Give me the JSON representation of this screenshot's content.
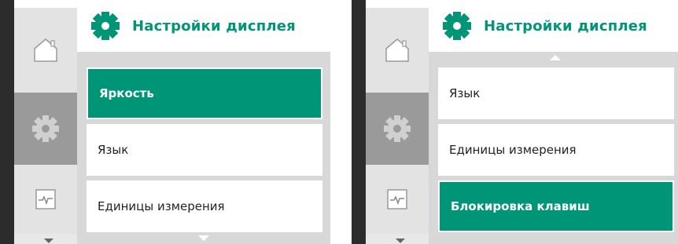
{
  "colors": {
    "accent": "#009577",
    "nav_active": "#9a9a9a",
    "nav_idle": "#e3e3e3",
    "menu_bg": "#d8d8d8"
  },
  "screens": [
    {
      "header": {
        "title": "Настройки дисплея",
        "icon": "gear-icon"
      },
      "nav": [
        "home-icon",
        "gear-icon",
        "diagnostics-icon"
      ],
      "items": [
        {
          "label": "Яркость",
          "selected": true
        },
        {
          "label": "Язык",
          "selected": false
        },
        {
          "label": "Единицы измерения",
          "selected": false
        }
      ]
    },
    {
      "header": {
        "title": "Настройки дисплея",
        "icon": "gear-icon"
      },
      "nav": [
        "home-icon",
        "gear-icon",
        "diagnostics-icon"
      ],
      "items": [
        {
          "label": "Язык",
          "selected": false
        },
        {
          "label": "Единицы измерения",
          "selected": false
        },
        {
          "label": "Блокировка клавиш",
          "selected": true
        }
      ]
    }
  ]
}
